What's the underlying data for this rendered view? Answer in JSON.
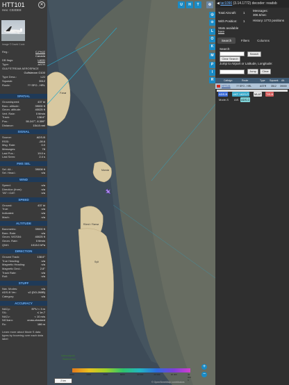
{
  "left": {
    "callsign": "HTT101",
    "hex": "Hex: C02DE8",
    "photo_credit": "Image © David Cook",
    "info": [
      {
        "k": "Reg.:",
        "v": "C-FHJZ",
        "link": true
      },
      {
        "k": "",
        "v": "Canada",
        "link": false
      },
      {
        "k": "DB flags:",
        "v": "LADD",
        "link": true
      },
      {
        "k": "Type:",
        "v": "ASTR",
        "link": false
      },
      {
        "k": "GULFSTREAM AEROSPACE",
        "v": "",
        "link": false
      },
      {
        "k": "",
        "v": "Gulfstream G100",
        "link": false
      },
      {
        "k": "Type Desc.:",
        "v": "L2J",
        "link": false
      },
      {
        "k": "Squawk:",
        "v": "3512",
        "link": false
      },
      {
        "k": "Route:",
        "v": "?? SFO - HRL",
        "link": false
      }
    ],
    "sections": [
      {
        "title": "SPATIAL",
        "rows": [
          [
            "Groundspeed:",
            "437 kt"
          ],
          [
            "Baro. altitude:",
            "39000 ft"
          ],
          [
            "Geom. altitude:",
            "40025 ft"
          ],
          [
            "Vert. Rate:",
            "0 ft/min"
          ],
          [
            "Track:",
            "138.6°"
          ],
          [
            "Pos.:",
            "55.247°, 8.359°"
          ],
          [
            "Distance:",
            "154.8 nmi"
          ]
        ]
      },
      {
        "title": "SIGNAL",
        "rows": [
          [
            "Source:",
            "ADS-B"
          ],
          [
            "RSSI:",
            "-28.6"
          ],
          [
            "Msg. Rate:",
            "0.0"
          ],
          [
            "Messages:",
            "78"
          ],
          [
            "Last Pos.:",
            "19.0 s"
          ],
          [
            "Last Seen:",
            "2.4 s"
          ]
        ]
      },
      {
        "title": "FMS SEL",
        "rows": [
          [
            "Sel. Alt.:",
            "39008 ft"
          ],
          [
            "Sel. Head.:",
            "n/a"
          ]
        ]
      },
      {
        "title": "WIND",
        "rows": [
          [
            "Speed:",
            "n/a"
          ],
          [
            "Direction (from):",
            "n/a"
          ],
          [
            "TAT / OAT:",
            "n/a"
          ]
        ]
      },
      {
        "title": "SPEED",
        "rows": [
          [
            "Ground:",
            "437 kt"
          ],
          [
            "True:",
            "n/a"
          ],
          [
            "Indicated:",
            "n/a"
          ],
          [
            "Mach:",
            "n/a"
          ]
        ]
      },
      {
        "title": "ALTITUDE",
        "rows": [
          [
            "Barometric:",
            "39000 ft"
          ],
          [
            "Baro. Rate:",
            "n/a"
          ],
          [
            "Geom. WGS84:",
            "40025 ft"
          ],
          [
            "Geom. Rate:",
            "0 ft/min"
          ],
          [
            "QNH:",
            "1013.0 hPa"
          ]
        ]
      },
      {
        "title": "DIRECTION",
        "rows": [
          [
            "Ground Track:",
            "138.6°"
          ],
          [
            "True Heading:",
            "n/a"
          ],
          [
            "Magnetic Heading:",
            "n/a"
          ],
          [
            "Magnetic Decl.:",
            "2.8°"
          ],
          [
            "Track Rate:",
            "n/a"
          ],
          [
            "Roll:",
            "n/a"
          ]
        ]
      },
      {
        "title": "STUFF",
        "rows": [
          [
            "Nav. Modes:",
            "n/a"
          ],
          [
            "ADS-B Ver.:",
            "v2 (DO-260B)"
          ],
          [
            "Category:",
            "n/a"
          ]
        ]
      },
      {
        "title": "ACCURACY",
        "rows": [
          [
            "NACp:",
            "EPU < 3 m"
          ],
          [
            "SIL:",
            "≤ 1e-7"
          ],
          [
            "NACv:",
            "< 10 m/s"
          ],
          [
            "NICbaro:",
            "cross-checked"
          ],
          [
            "Rc:",
            "186 m"
          ]
        ]
      }
    ],
    "accuracy_note": "Learn more about Mode S data types by hovering over each data label"
  },
  "map": {
    "top_buttons": [
      "U",
      "H",
      "T"
    ],
    "side_buttons": [
      "L",
      "O",
      "K",
      "M",
      "P",
      "I",
      "R"
    ],
    "zoom_in": "+",
    "zoom_out": "−",
    "scale_label": "2 km",
    "altitude_ticks": [
      "2000",
      "4000",
      "6000",
      "8000",
      "10 000",
      "20 000",
      "30 000",
      "40 000 ft"
    ],
    "attribution": "© OpenStreetMap contributors",
    "labels": [
      "Fanø",
      "Mandø",
      "Römö / Rømø",
      "Sylt",
      "Nationalpark Wattenmeer"
    ]
  },
  "right": {
    "header_link": "tar1090",
    "header_version": "(3.14.1772)",
    "header_decoder": "decoder: readsb",
    "stats": {
      "total_aircraft_label": "Total Aircraft:",
      "total_aircraft": "1",
      "messages_label": "Messages:",
      "messages": "306.6/sec",
      "with_position_label": "With Position:",
      "with_position": "1",
      "history_label": "History:",
      "history": "1772 positions",
      "stats_available": "Stats available",
      "stats_link": "here"
    },
    "tabs": [
      "Search",
      "Filters",
      "Columns"
    ],
    "search_label": "Search:",
    "search_placeholder": "",
    "search_button": "Search",
    "clear_search_button": "Clear Search",
    "jump_label": "Jump to Airport or Latitude, Longitude:",
    "jump_button": "Jump",
    "clear_button": "Clear",
    "table_headers": [
      "Callsign",
      "Route",
      "Type",
      "Squawk",
      "Alt."
    ],
    "table_row": [
      "HTT101",
      "?? SFO - HRL",
      "ASTR",
      "3512",
      "39000"
    ],
    "legend": [
      {
        "label": "ADS-B",
        "color": "#3b6bd8"
      },
      {
        "label": "UAT / ADS-R",
        "color": "#38a9c9"
      },
      {
        "label": "MLAT",
        "color": "#e3e3e3"
      },
      {
        "label": "TIS-B",
        "color": "#d45c5c"
      },
      {
        "label": "Mode-S",
        "color": "#dddddd"
      },
      {
        "label": "AIS",
        "color": "#dddddd"
      },
      {
        "label": "ADS-C",
        "color": "#7fd3d8"
      }
    ]
  },
  "colors": {
    "accent": "#1a8ac4",
    "section_text": "#6fb5ff",
    "section_bg": "#1f3a58"
  }
}
